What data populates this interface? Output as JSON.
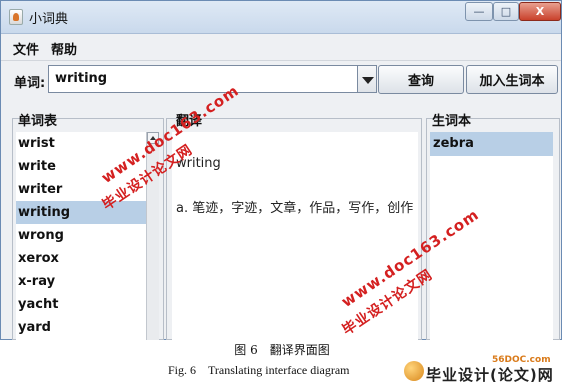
{
  "window": {
    "title": "小词典",
    "controls": {
      "minimize": "—",
      "maximize": "□",
      "close": "X"
    }
  },
  "menu": {
    "items": [
      "文件",
      "帮助"
    ]
  },
  "search": {
    "label": "单词:",
    "value": "writing",
    "query_button": "查询",
    "add_button": "加入生词本"
  },
  "word_list": {
    "title": "单词表",
    "items": [
      "wrist",
      "write",
      "writer",
      "writing",
      "wrong",
      "xerox",
      "x-ray",
      "yacht",
      "yard"
    ],
    "selected": "writing"
  },
  "translation": {
    "title": "翻译",
    "word": "writing",
    "definition": "a. 笔迹，字迹，文章，作品，写作，创作"
  },
  "vocab": {
    "title": "生词本",
    "items": [
      "zebra"
    ],
    "selected": "zebra"
  },
  "watermarks": {
    "url": "www.doc163.com",
    "cn": "毕业设计论文网"
  },
  "caption": {
    "cn": "图 6　翻译界面图",
    "en": "Fig. 6　Translating interface diagram"
  },
  "logo": {
    "url": "56DOC.com",
    "text": "毕业设计(论文)网"
  }
}
